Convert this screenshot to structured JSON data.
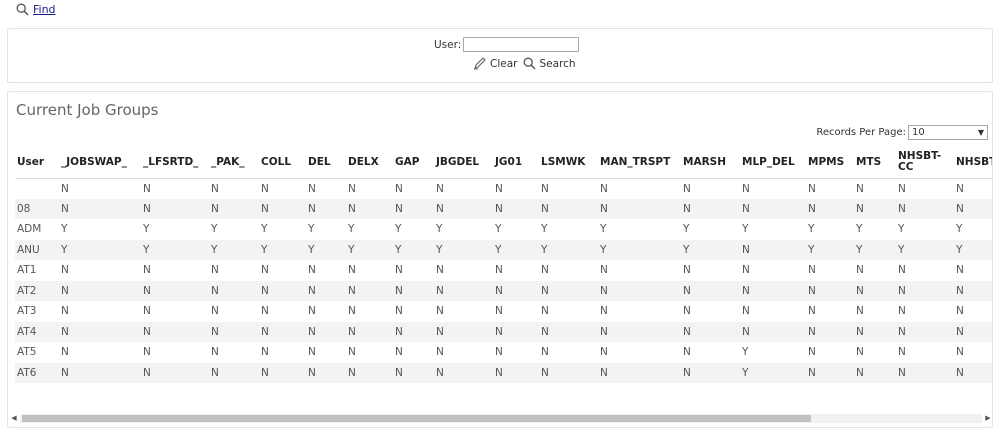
{
  "find": {
    "label": "Find"
  },
  "search": {
    "user_label": "User:",
    "user_value": "",
    "clear_label": "Clear",
    "search_label": "Search"
  },
  "grid": {
    "title": "Current Job Groups",
    "records_per_page_label": "Records Per Page:",
    "records_per_page_value": "10",
    "scroll_fraction": 0.82,
    "columns": [
      "User",
      "_JOBSWAP_",
      "_LFSRTD_",
      "_PAK_",
      "COLL",
      "DEL",
      "DELX",
      "GAP",
      "JBGDEL",
      "JG01",
      "LSMWK",
      "MAN_TRSPT",
      "MARSH",
      "MLP_DEL",
      "MPMS",
      "MTS",
      "NHSBT-CC",
      "NHSBT-JAV"
    ],
    "rows": [
      [
        "",
        "N",
        "N",
        "N",
        "N",
        "N",
        "N",
        "N",
        "N",
        "N",
        "N",
        "N",
        "N",
        "N",
        "N",
        "N",
        "N",
        "N"
      ],
      [
        "08",
        "N",
        "N",
        "N",
        "N",
        "N",
        "N",
        "N",
        "N",
        "N",
        "N",
        "N",
        "N",
        "N",
        "N",
        "N",
        "N",
        "N"
      ],
      [
        "ADM",
        "Y",
        "Y",
        "Y",
        "Y",
        "Y",
        "Y",
        "Y",
        "Y",
        "Y",
        "Y",
        "Y",
        "Y",
        "Y",
        "Y",
        "Y",
        "Y",
        "Y"
      ],
      [
        "ANU",
        "Y",
        "Y",
        "Y",
        "Y",
        "Y",
        "Y",
        "Y",
        "Y",
        "Y",
        "Y",
        "Y",
        "Y",
        "N",
        "Y",
        "Y",
        "Y",
        "Y"
      ],
      [
        "AT1",
        "N",
        "N",
        "N",
        "N",
        "N",
        "N",
        "N",
        "N",
        "N",
        "N",
        "N",
        "N",
        "N",
        "N",
        "N",
        "N",
        "N"
      ],
      [
        "AT2",
        "N",
        "N",
        "N",
        "N",
        "N",
        "N",
        "N",
        "N",
        "N",
        "N",
        "N",
        "N",
        "N",
        "N",
        "N",
        "N",
        "N"
      ],
      [
        "AT3",
        "N",
        "N",
        "N",
        "N",
        "N",
        "N",
        "N",
        "N",
        "N",
        "N",
        "N",
        "N",
        "N",
        "N",
        "N",
        "N",
        "N"
      ],
      [
        "AT4",
        "N",
        "N",
        "N",
        "N",
        "N",
        "N",
        "N",
        "N",
        "N",
        "N",
        "N",
        "N",
        "N",
        "N",
        "N",
        "N",
        "N"
      ],
      [
        "AT5",
        "N",
        "N",
        "N",
        "N",
        "N",
        "N",
        "N",
        "N",
        "N",
        "N",
        "N",
        "N",
        "Y",
        "N",
        "N",
        "N",
        "N"
      ],
      [
        "AT6",
        "N",
        "N",
        "N",
        "N",
        "N",
        "N",
        "N",
        "N",
        "N",
        "N",
        "N",
        "N",
        "Y",
        "N",
        "N",
        "N",
        "N"
      ]
    ]
  }
}
